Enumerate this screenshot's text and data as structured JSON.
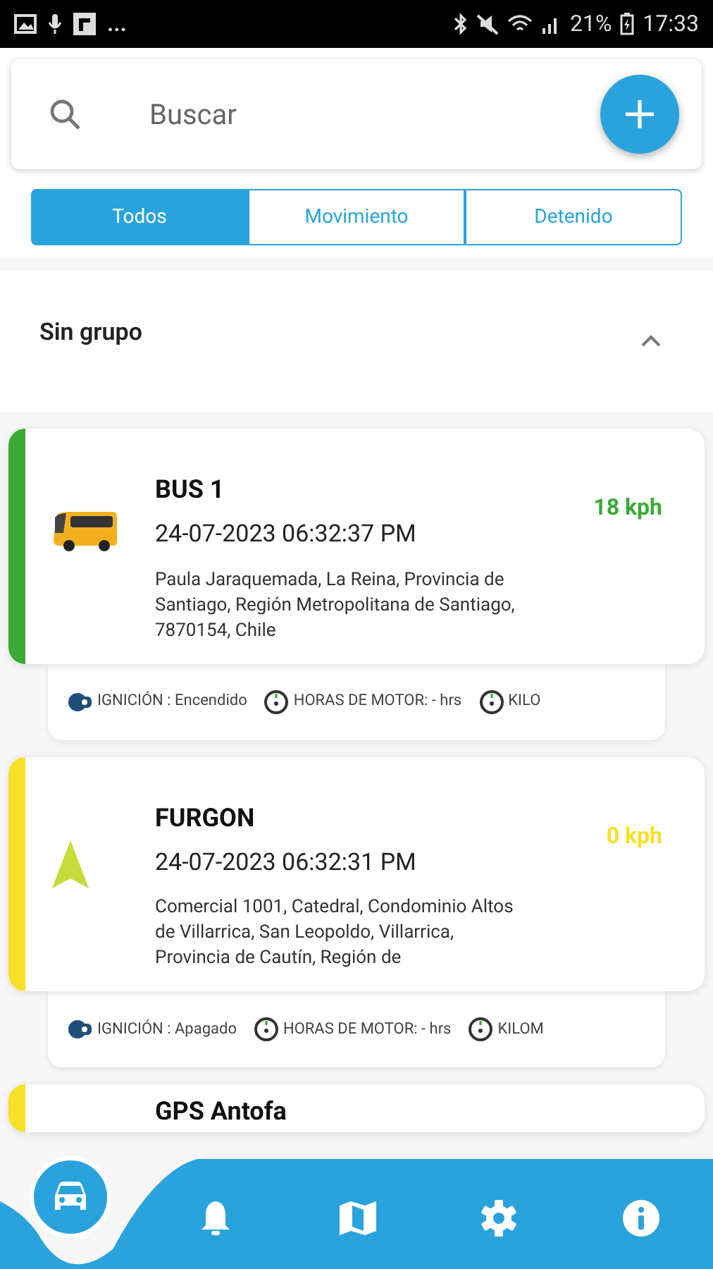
{
  "status_bar": {
    "more": "...",
    "battery": "21%",
    "time": "17:33"
  },
  "search": {
    "placeholder": "Buscar"
  },
  "tabs": [
    {
      "label": "Todos",
      "selected": true
    },
    {
      "label": "Movimiento",
      "selected": false
    },
    {
      "label": "Detenido",
      "selected": false
    }
  ],
  "group": {
    "title": "Sin grupo",
    "expanded": true
  },
  "vehicles": [
    {
      "kind": "bus",
      "name": "BUS 1",
      "time": "24-07-2023 06:32:37 PM",
      "address": "Paula Jaraquemada, La Reina, Provincia de Santiago, Región Metropolitana de Santiago, 7870154, Chile",
      "speed": "18 kph",
      "color": "#3aaa35",
      "details": [
        "IGNICIÓN : Encendido",
        "HORAS DE MOTOR: - hrs",
        "KILO"
      ]
    },
    {
      "kind": "arrow",
      "name": "FURGON",
      "time": "24-07-2023 06:32:31 PM",
      "address": "Comercial 1001, Catedral, Condominio Altos de Villarrica, San Leopoldo, Villarrica, Provincia de Cautín, Región de",
      "speed": "0 kph",
      "color": "#f5e12a",
      "details": [
        "IGNICIÓN : Apagado",
        "HORAS DE MOTOR: - hrs",
        "KILOM"
      ]
    },
    {
      "kind": "partial",
      "name": "GPS Antofa",
      "color": "#f5e12a"
    }
  ],
  "nav": [
    {
      "kind": "car",
      "selected": true
    },
    {
      "kind": "bell",
      "selected": false
    },
    {
      "kind": "map",
      "selected": false
    },
    {
      "kind": "gear",
      "selected": false
    },
    {
      "kind": "info",
      "selected": false
    }
  ]
}
